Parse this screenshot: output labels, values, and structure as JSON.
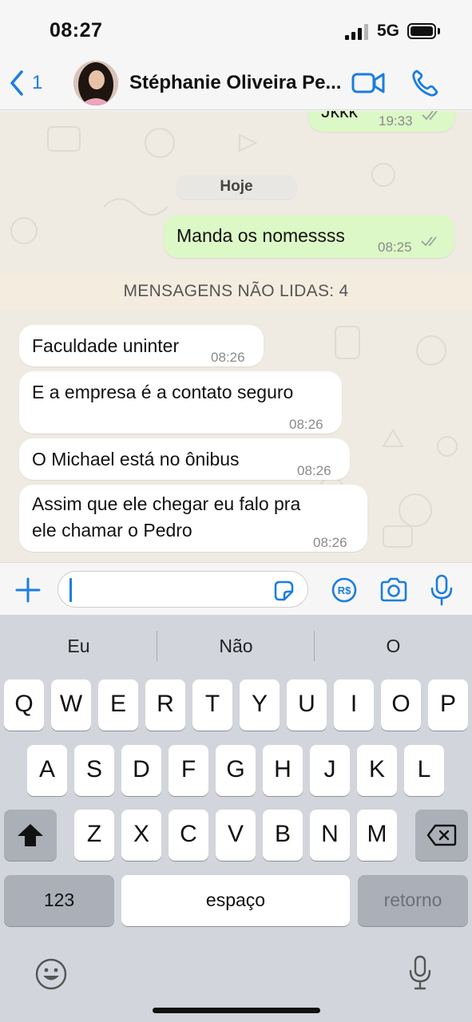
{
  "status_bar": {
    "time": "08:27",
    "network": "5G"
  },
  "header": {
    "back_count": "1",
    "contact_name": "Stéphanie Oliveira Pe..."
  },
  "chat": {
    "partial_message": {
      "text": "Jkkk",
      "time": "19:33"
    },
    "day_label": "Hoje",
    "outgoing": {
      "text": "Manda os nomessss",
      "time": "08:25"
    },
    "unread_banner": "MENSAGENS NÃO LIDAS: 4",
    "incoming": [
      {
        "lines": [
          "Faculdade uninter"
        ],
        "time": "08:26"
      },
      {
        "lines": [
          "E a empresa é a contato seguro"
        ],
        "time": "08:26"
      },
      {
        "lines": [
          "O Michael está no ônibus"
        ],
        "time": "08:26"
      },
      {
        "lines": [
          "Assim que ele chegar eu falo pra",
          "ele chamar o Pedro"
        ],
        "time": "08:26"
      }
    ]
  },
  "input_bar": {
    "value": "",
    "icons": [
      "plus-icon",
      "sticker-icon",
      "pix-payment-icon",
      "camera-icon",
      "microphone-icon"
    ]
  },
  "keyboard": {
    "suggestions": [
      "Eu",
      "Não",
      "O"
    ],
    "row1": [
      "Q",
      "W",
      "E",
      "R",
      "T",
      "Y",
      "U",
      "I",
      "O",
      "P"
    ],
    "row2": [
      "A",
      "S",
      "D",
      "F",
      "G",
      "H",
      "J",
      "K",
      "L"
    ],
    "row3": [
      "Z",
      "X",
      "C",
      "V",
      "B",
      "N",
      "M"
    ],
    "numbers_label": "123",
    "space_label": "espaço",
    "return_label": "retorno"
  },
  "colors": {
    "accent_blue": "#1a7de0",
    "outgoing_bubble": "#dcf8c6",
    "incoming_bubble": "#ffffff",
    "chat_background": "#efeae2",
    "unread_banner_bg": "#f4ecdf",
    "keyboard_bg": "#d2d5db"
  }
}
